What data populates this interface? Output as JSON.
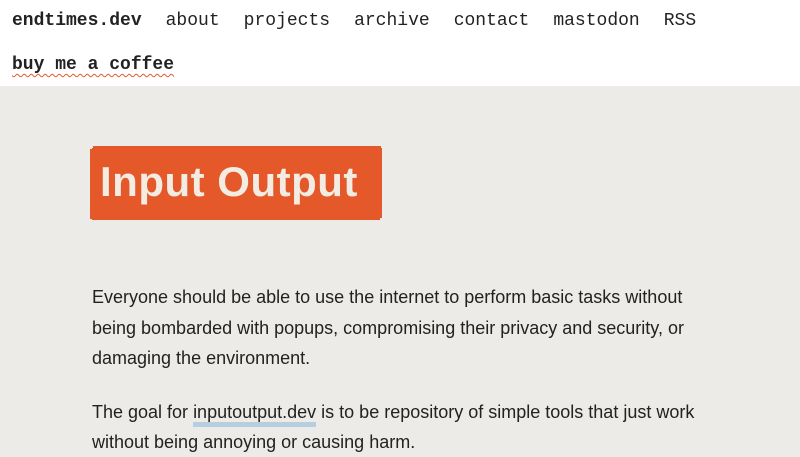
{
  "header": {
    "brand": "endtimes.dev",
    "nav": [
      {
        "label": "about"
      },
      {
        "label": "projects"
      },
      {
        "label": "archive"
      },
      {
        "label": "contact"
      },
      {
        "label": "mastodon"
      },
      {
        "label": "RSS"
      }
    ],
    "coffee_label": "buy me a coffee"
  },
  "main": {
    "title": "Input Output",
    "intro": "Everyone should be able to use the internet to perform basic tasks without being bombarded with popups, compromising their privacy and security, or damaging the environment.",
    "goal_prefix": "The goal for ",
    "goal_link": "inputoutput.dev",
    "goal_suffix": " is to be repository of simple tools that just work without being annoying or causing harm."
  },
  "colors": {
    "background": "#edebe7",
    "header_background": "#ffffff",
    "accent": "#e4582a",
    "title_text": "#f3ece2",
    "link_underline": "#b7cde0",
    "text": "#222222"
  }
}
